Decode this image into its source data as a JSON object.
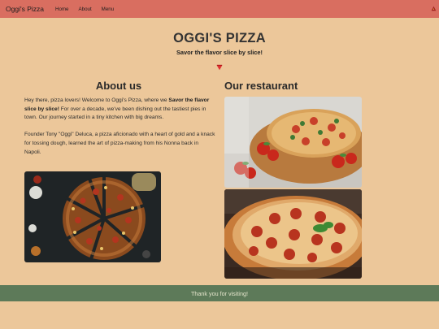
{
  "navbar": {
    "brand": "Oggi's Pizza",
    "links": [
      "Home",
      "About",
      "Menu"
    ]
  },
  "header": {
    "title": "OGGI'S PIZZA",
    "tagline": "Savor the flavor slice by slice!"
  },
  "about": {
    "heading": "About us",
    "intro_start": "Hey there, pizza lovers! Welcome to Oggi's Pizza, where we ",
    "intro_bold": "Savor the flavor slice by slice!",
    "intro_end": " For over a decade, we've been dishing out the tastiest pies in town. Our journey started in a tiny kitchen with big dreams.",
    "founder": "Founder Tony \"Oggi\" Deluca, a pizza aficionado with a heart of gold and a knack for tossing dough, learned the art of pizza-making from his Nonna back in Napoli."
  },
  "restaurant": {
    "heading": "Our restaurant"
  },
  "footer": {
    "text": "Thank you for visiting!"
  },
  "colors": {
    "background": "#ecc79a",
    "navbar": "#d96e60",
    "footer": "#5d7a59",
    "accent": "#e03030"
  },
  "icons": [
    "hamburger-toggler-icon",
    "pizza-slice-divider-icon"
  ]
}
